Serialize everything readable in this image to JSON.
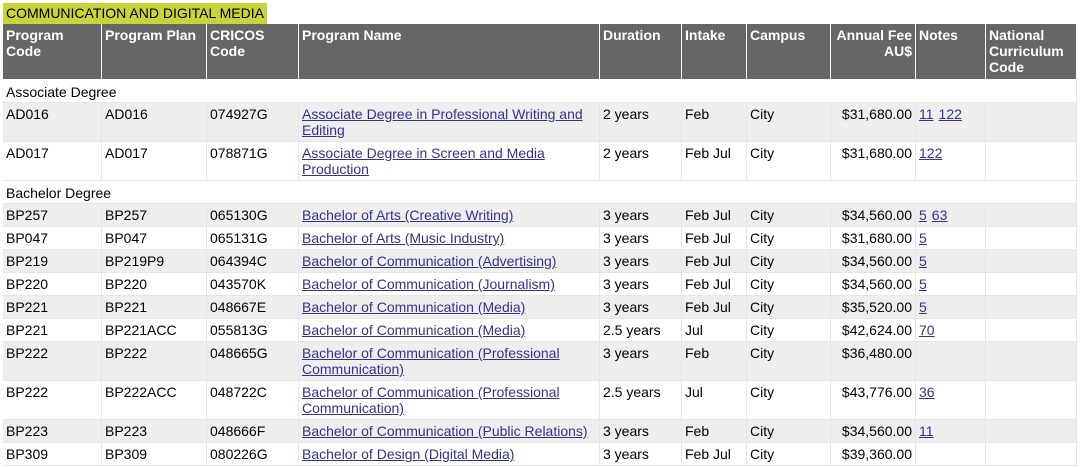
{
  "section_title": "COMMUNICATION AND DIGITAL MEDIA",
  "columns": [
    "Program Code",
    "Program Plan",
    "CRICOS Code",
    "Program Name",
    "Duration",
    "Intake",
    "Campus",
    "Annual Fee AU$",
    "Notes",
    "National Curriculum Code"
  ],
  "rows": [
    {
      "kind": "group",
      "label": "Associate Degree"
    },
    {
      "kind": "program",
      "code": "AD016",
      "plan": "AD016",
      "cricos": "074927G",
      "name": "Associate Degree in Professional Writing and Editing",
      "duration": "2 years",
      "intake": "Feb",
      "campus": "City",
      "fee": "$31,680.00",
      "notes": [
        "11",
        "122"
      ],
      "ncc": ""
    },
    {
      "kind": "program",
      "code": "AD017",
      "plan": "AD017",
      "cricos": "078871G",
      "name": "Associate Degree in Screen and Media Production",
      "duration": "2 years",
      "intake": "Feb Jul",
      "campus": "City",
      "fee": "$31,680.00",
      "notes": [
        "122"
      ],
      "ncc": ""
    },
    {
      "kind": "group",
      "label": "Bachelor Degree"
    },
    {
      "kind": "program",
      "code": "BP257",
      "plan": "BP257",
      "cricos": "065130G",
      "name": "Bachelor of Arts (Creative Writing)",
      "duration": "3 years",
      "intake": "Feb Jul",
      "campus": "City",
      "fee": "$34,560.00",
      "notes": [
        "5",
        "63"
      ],
      "ncc": ""
    },
    {
      "kind": "program",
      "code": "BP047",
      "plan": "BP047",
      "cricos": "065131G",
      "name": "Bachelor of Arts (Music Industry)",
      "duration": "3 years",
      "intake": "Feb Jul",
      "campus": "City",
      "fee": "$31,680.00",
      "notes": [
        "5"
      ],
      "ncc": ""
    },
    {
      "kind": "program",
      "code": "BP219",
      "plan": "BP219P9",
      "cricos": "064394C",
      "name": "Bachelor of Communication (Advertising)",
      "duration": "3 years",
      "intake": "Feb Jul",
      "campus": "City",
      "fee": "$34,560.00",
      "notes": [
        "5"
      ],
      "ncc": ""
    },
    {
      "kind": "program",
      "code": "BP220",
      "plan": "BP220",
      "cricos": "043570K",
      "name": "Bachelor of Communication (Journalism)",
      "duration": "3 years",
      "intake": "Feb Jul",
      "campus": "City",
      "fee": "$34,560.00",
      "notes": [
        "5"
      ],
      "ncc": ""
    },
    {
      "kind": "program",
      "code": "BP221",
      "plan": "BP221",
      "cricos": "048667E",
      "name": "Bachelor of Communication (Media)",
      "duration": "3 years",
      "intake": "Feb Jul",
      "campus": "City",
      "fee": "$35,520.00",
      "notes": [
        "5"
      ],
      "ncc": ""
    },
    {
      "kind": "program",
      "code": "BP221",
      "plan": "BP221ACC",
      "cricos": "055813G",
      "name": "Bachelor of Communication (Media)",
      "duration": "2.5 years",
      "intake": "Jul",
      "campus": "City",
      "fee": "$42,624.00",
      "notes": [
        "70"
      ],
      "ncc": ""
    },
    {
      "kind": "program",
      "code": "BP222",
      "plan": "BP222",
      "cricos": "048665G",
      "name": "Bachelor of Communication (Professional Communication)",
      "duration": "3 years",
      "intake": "Feb",
      "campus": "City",
      "fee": "$36,480.00",
      "notes": [],
      "ncc": ""
    },
    {
      "kind": "program",
      "code": "BP222",
      "plan": "BP222ACC",
      "cricos": "048722C",
      "name": "Bachelor of Communication (Professional Communication)",
      "duration": "2.5 years",
      "intake": "Jul",
      "campus": "City",
      "fee": "$43,776.00",
      "notes": [
        "36"
      ],
      "ncc": ""
    },
    {
      "kind": "program",
      "code": "BP223",
      "plan": "BP223",
      "cricos": "048666F",
      "name": "Bachelor of Communication (Public Relations)",
      "duration": "3 years",
      "intake": "Feb",
      "campus": "City",
      "fee": "$34,560.00",
      "notes": [
        "11"
      ],
      "ncc": ""
    },
    {
      "kind": "program",
      "code": "BP309",
      "plan": "BP309",
      "cricos": "080226G",
      "name": "Bachelor of Design (Digital Media)",
      "duration": "3 years",
      "intake": "Feb Jul",
      "campus": "City",
      "fee": "$39,360.00",
      "notes": [],
      "ncc": ""
    }
  ]
}
